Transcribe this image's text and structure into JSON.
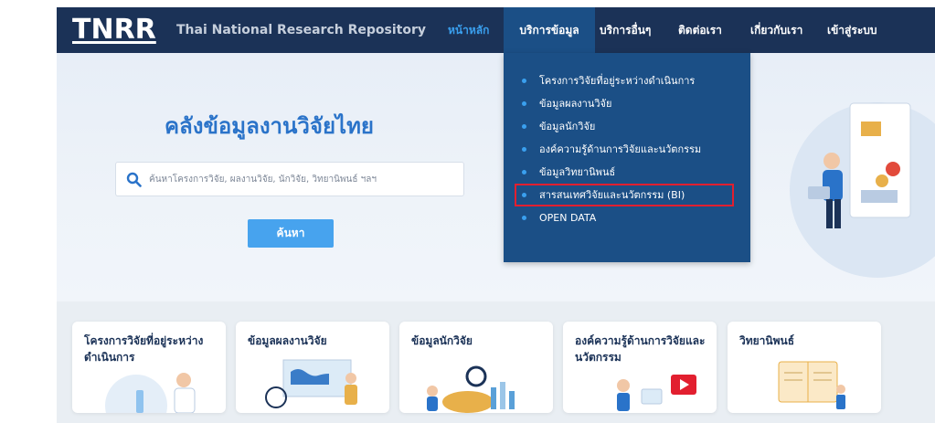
{
  "header": {
    "logo": "TNRR",
    "subtitle": "Thai National Research Repository",
    "nav": [
      {
        "label": "หน้าหลัก"
      },
      {
        "label": "บริการข้อมูล"
      },
      {
        "label": "บริการอื่นๆ"
      },
      {
        "label": "ติดต่อเรา"
      },
      {
        "label": "เกี่ยวกับเรา"
      },
      {
        "label": "เข้าสู่ระบบ"
      }
    ]
  },
  "hero": {
    "title": "คลังข้อมูลงานวิจัยไทย",
    "search_placeholder": "ค้นหาโครงการวิจัย, ผลงานวิจัย, นักวิจัย, วิทยานิพนธ์ ฯลฯ",
    "search_button": "ค้นหา"
  },
  "dropdown": {
    "items": [
      {
        "label": "โครงการวิจัยที่อยู่ระหว่างดำเนินการ"
      },
      {
        "label": "ข้อมูลผลงานวิจัย"
      },
      {
        "label": "ข้อมูลนักวิจัย"
      },
      {
        "label": "องค์ความรู้ด้านการวิจัยและนวัตกรรม"
      },
      {
        "label": "ข้อมูลวิทยานิพนธ์"
      },
      {
        "label": "สารสนเทศวิจัยและนวัตกรรม (BI)"
      },
      {
        "label": "OPEN DATA"
      }
    ],
    "highlight_color": "#e21f2f"
  },
  "cards": [
    {
      "title": "โครงการวิจัยที่อยู่ระหว่างดำเนินการ"
    },
    {
      "title": "ข้อมูลผลงานวิจัย"
    },
    {
      "title": "ข้อมูลนักวิจัย"
    },
    {
      "title": "องค์ความรู้ด้านการวิจัยและนวัตกรรม"
    },
    {
      "title": "วิทยานิพนธ์"
    }
  ],
  "colors": {
    "header_bg": "#1b3257",
    "active_nav_bg": "#1b4f86",
    "accent": "#3aa0ef",
    "search_button_bg": "#47a3ee"
  }
}
